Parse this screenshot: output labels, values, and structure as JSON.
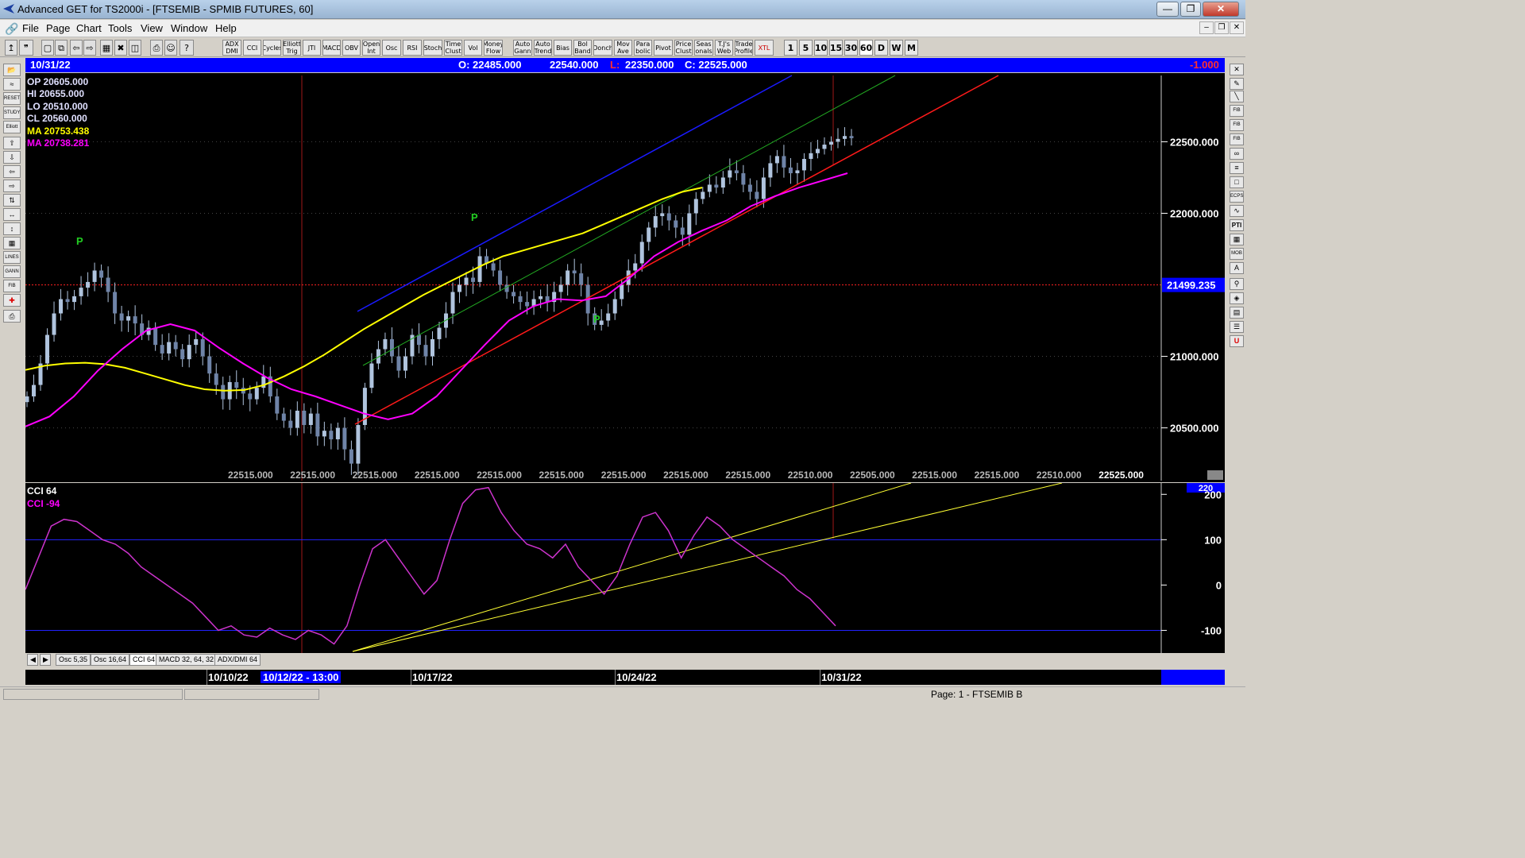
{
  "window": {
    "title": "Advanced GET for TS2000i - [FTSEMIB - SPMIB FUTURES, 60]"
  },
  "menu": [
    "File",
    "Page",
    "Chart",
    "Tools",
    "View",
    "Window",
    "Help"
  ],
  "toolbar": {
    "studies": [
      "ADX DMI",
      "CCI",
      "Cycles",
      "Elliott Trig",
      "JTI",
      "MACD",
      "OBV",
      "Open Int",
      "Osc",
      "RSI",
      "Stoch",
      "Time Clust",
      "Vol",
      "Money Flow",
      "Auto Gann",
      "Auto Trend",
      "Bias",
      "Bol Band",
      "Donch",
      "Mov Ave",
      "Para bolic",
      "Pivot",
      "Price Clust",
      "Seas onals",
      "T.J's Web",
      "Trade Profile",
      "XTL"
    ],
    "intervals": [
      "1",
      "5",
      "10",
      "15",
      "30",
      "60",
      "D",
      "W",
      "M"
    ],
    "active_interval": "60"
  },
  "header": {
    "date": "10/31/22",
    "open": "O: 22485.000",
    "high": "22540.000",
    "low_label": "L:",
    "low": "22350.000",
    "close": "C: 22525.000",
    "change": "-1.000"
  },
  "legend": {
    "op": "OP  20605.000",
    "hi": "HI   20655.000",
    "lo": "LO  20510.000",
    "cl": "CL  20560.000",
    "ma1": "MA  20753.438",
    "ma2": "MA  20738.281"
  },
  "price_axis": {
    "ticks": [
      "22500.000",
      "22000.000",
      "21000.000",
      "20500.000"
    ],
    "tick_values": [
      22500,
      22000,
      21000,
      20500
    ],
    "marker": "21499.235",
    "marker_value": 21499.235
  },
  "bottom_values": [
    "22515.000",
    "22515.000",
    "22515.000",
    "22515.000",
    "22515.000",
    "22515.000",
    "22515.000",
    "22515.000",
    "22515.000",
    "22510.000",
    "22505.000",
    "22515.000",
    "22515.000",
    "22510.000",
    "22525.000"
  ],
  "pivot_labels": [
    "P",
    "P",
    "P"
  ],
  "cci": {
    "title": "CCI 64",
    "value_label": "CCI  -94",
    "ticks": [
      "200",
      "100",
      "0",
      "-100"
    ],
    "tick_values": [
      200,
      100,
      0,
      -100
    ],
    "marker": "220"
  },
  "tabs": [
    "Osc 5,35",
    "Osc 16,64",
    "CCI 64",
    "MACD 32, 64, 32",
    "ADX/DMI 64"
  ],
  "active_tab": "CCI 64",
  "dates": [
    "10/10/22",
    "10/12/22 - 13:00",
    "10/17/22",
    "10/24/22",
    "10/31/22"
  ],
  "status": "Page: 1 - FTSEMIB B",
  "colors": {
    "bull_candle": "#b0c4de",
    "ma_yellow": "#ffff00",
    "ma_magenta": "#ff00ff",
    "cci_line": "#cc33cc",
    "channel_blue": "#1a1aff",
    "channel_red": "#ff1a1a",
    "channel_green": "#22aa22",
    "pivot": "#22cc22",
    "marker_blue": "#0000ff"
  },
  "chart_data": {
    "type": "line",
    "title": "",
    "ylabel": "",
    "ylim": [
      20120,
      22980
    ],
    "series": [
      {
        "name": "",
        "values": [
          20720,
          20800,
          20950,
          21150,
          21300,
          21400,
          21380,
          21420,
          21480,
          21520,
          21600,
          21550,
          21450,
          21300,
          21250,
          21280,
          21230,
          21150,
          21200,
          21080,
          21020,
          21100,
          21050,
          20980,
          21080,
          21120,
          21000,
          20880,
          20800,
          20700,
          20820,
          20780,
          20740,
          20700,
          20780,
          20860,
          20720,
          20600,
          20550,
          20500,
          20620,
          20520,
          20600,
          20440,
          20480,
          20420,
          20500,
          20350,
          20250,
          20520,
          20780,
          20950,
          21050,
          21120,
          21000,
          20900,
          21000,
          21150,
          21080,
          21000,
          21120,
          21200,
          21300,
          21450,
          21500,
          21550,
          21520,
          21700,
          21650,
          21600,
          21500,
          21450,
          21420,
          21380,
          21350,
          21400,
          21420,
          21380,
          21450,
          21500,
          21600,
          21580,
          21500,
          21300,
          21220,
          21250,
          21300,
          21400,
          21500,
          21600,
          21650,
          21800,
          21900,
          21980,
          22000,
          21950,
          21900,
          21850,
          22000,
          22100,
          22150,
          22200,
          22180,
          22250,
          22300,
          22280,
          22200,
          22150,
          22100,
          22250,
          22350,
          22400,
          22320,
          22280,
          22300,
          22380,
          22420,
          22450,
          22480,
          22500,
          22520,
          22540,
          22525
        ]
      },
      {
        "name": "MA",
        "values": [
          20905,
          20935,
          20950,
          20955,
          20945,
          20920,
          20880,
          20840,
          20800,
          20770,
          20760,
          20765,
          20800,
          20860,
          20930,
          21010,
          21100,
          21190,
          21270,
          21350,
          21430,
          21500,
          21570,
          21640,
          21700,
          21740,
          21780,
          21820,
          21860,
          21920,
          21980,
          22040,
          22100,
          22150,
          22180
        ]
      },
      {
        "name": "MA",
        "values": [
          20510,
          20580,
          20720,
          20900,
          21050,
          21180,
          21225,
          21180,
          21060,
          20950,
          20850,
          20770,
          20720,
          20660,
          20600,
          20560,
          20600,
          20720,
          20900,
          21080,
          21250,
          21350,
          21400,
          21390,
          21420,
          21550,
          21700,
          21800,
          21880,
          21950,
          22050,
          22120,
          22180,
          22230,
          22280
        ]
      },
      {
        "name": "CCI 64",
        "values": [
          -10,
          60,
          130,
          145,
          140,
          120,
          100,
          90,
          70,
          40,
          20,
          0,
          -20,
          -40,
          -70,
          -100,
          -90,
          -110,
          -115,
          -95,
          -110,
          -120,
          -100,
          -110,
          -130,
          -90,
          0,
          80,
          100,
          60,
          20,
          -20,
          10,
          100,
          180,
          210,
          215,
          160,
          120,
          90,
          80,
          60,
          90,
          40,
          10,
          -20,
          20,
          90,
          150,
          160,
          120,
          60,
          110,
          150,
          130,
          100,
          80,
          60,
          40,
          20,
          -10,
          -30,
          -60,
          -90
        ]
      }
    ]
  }
}
